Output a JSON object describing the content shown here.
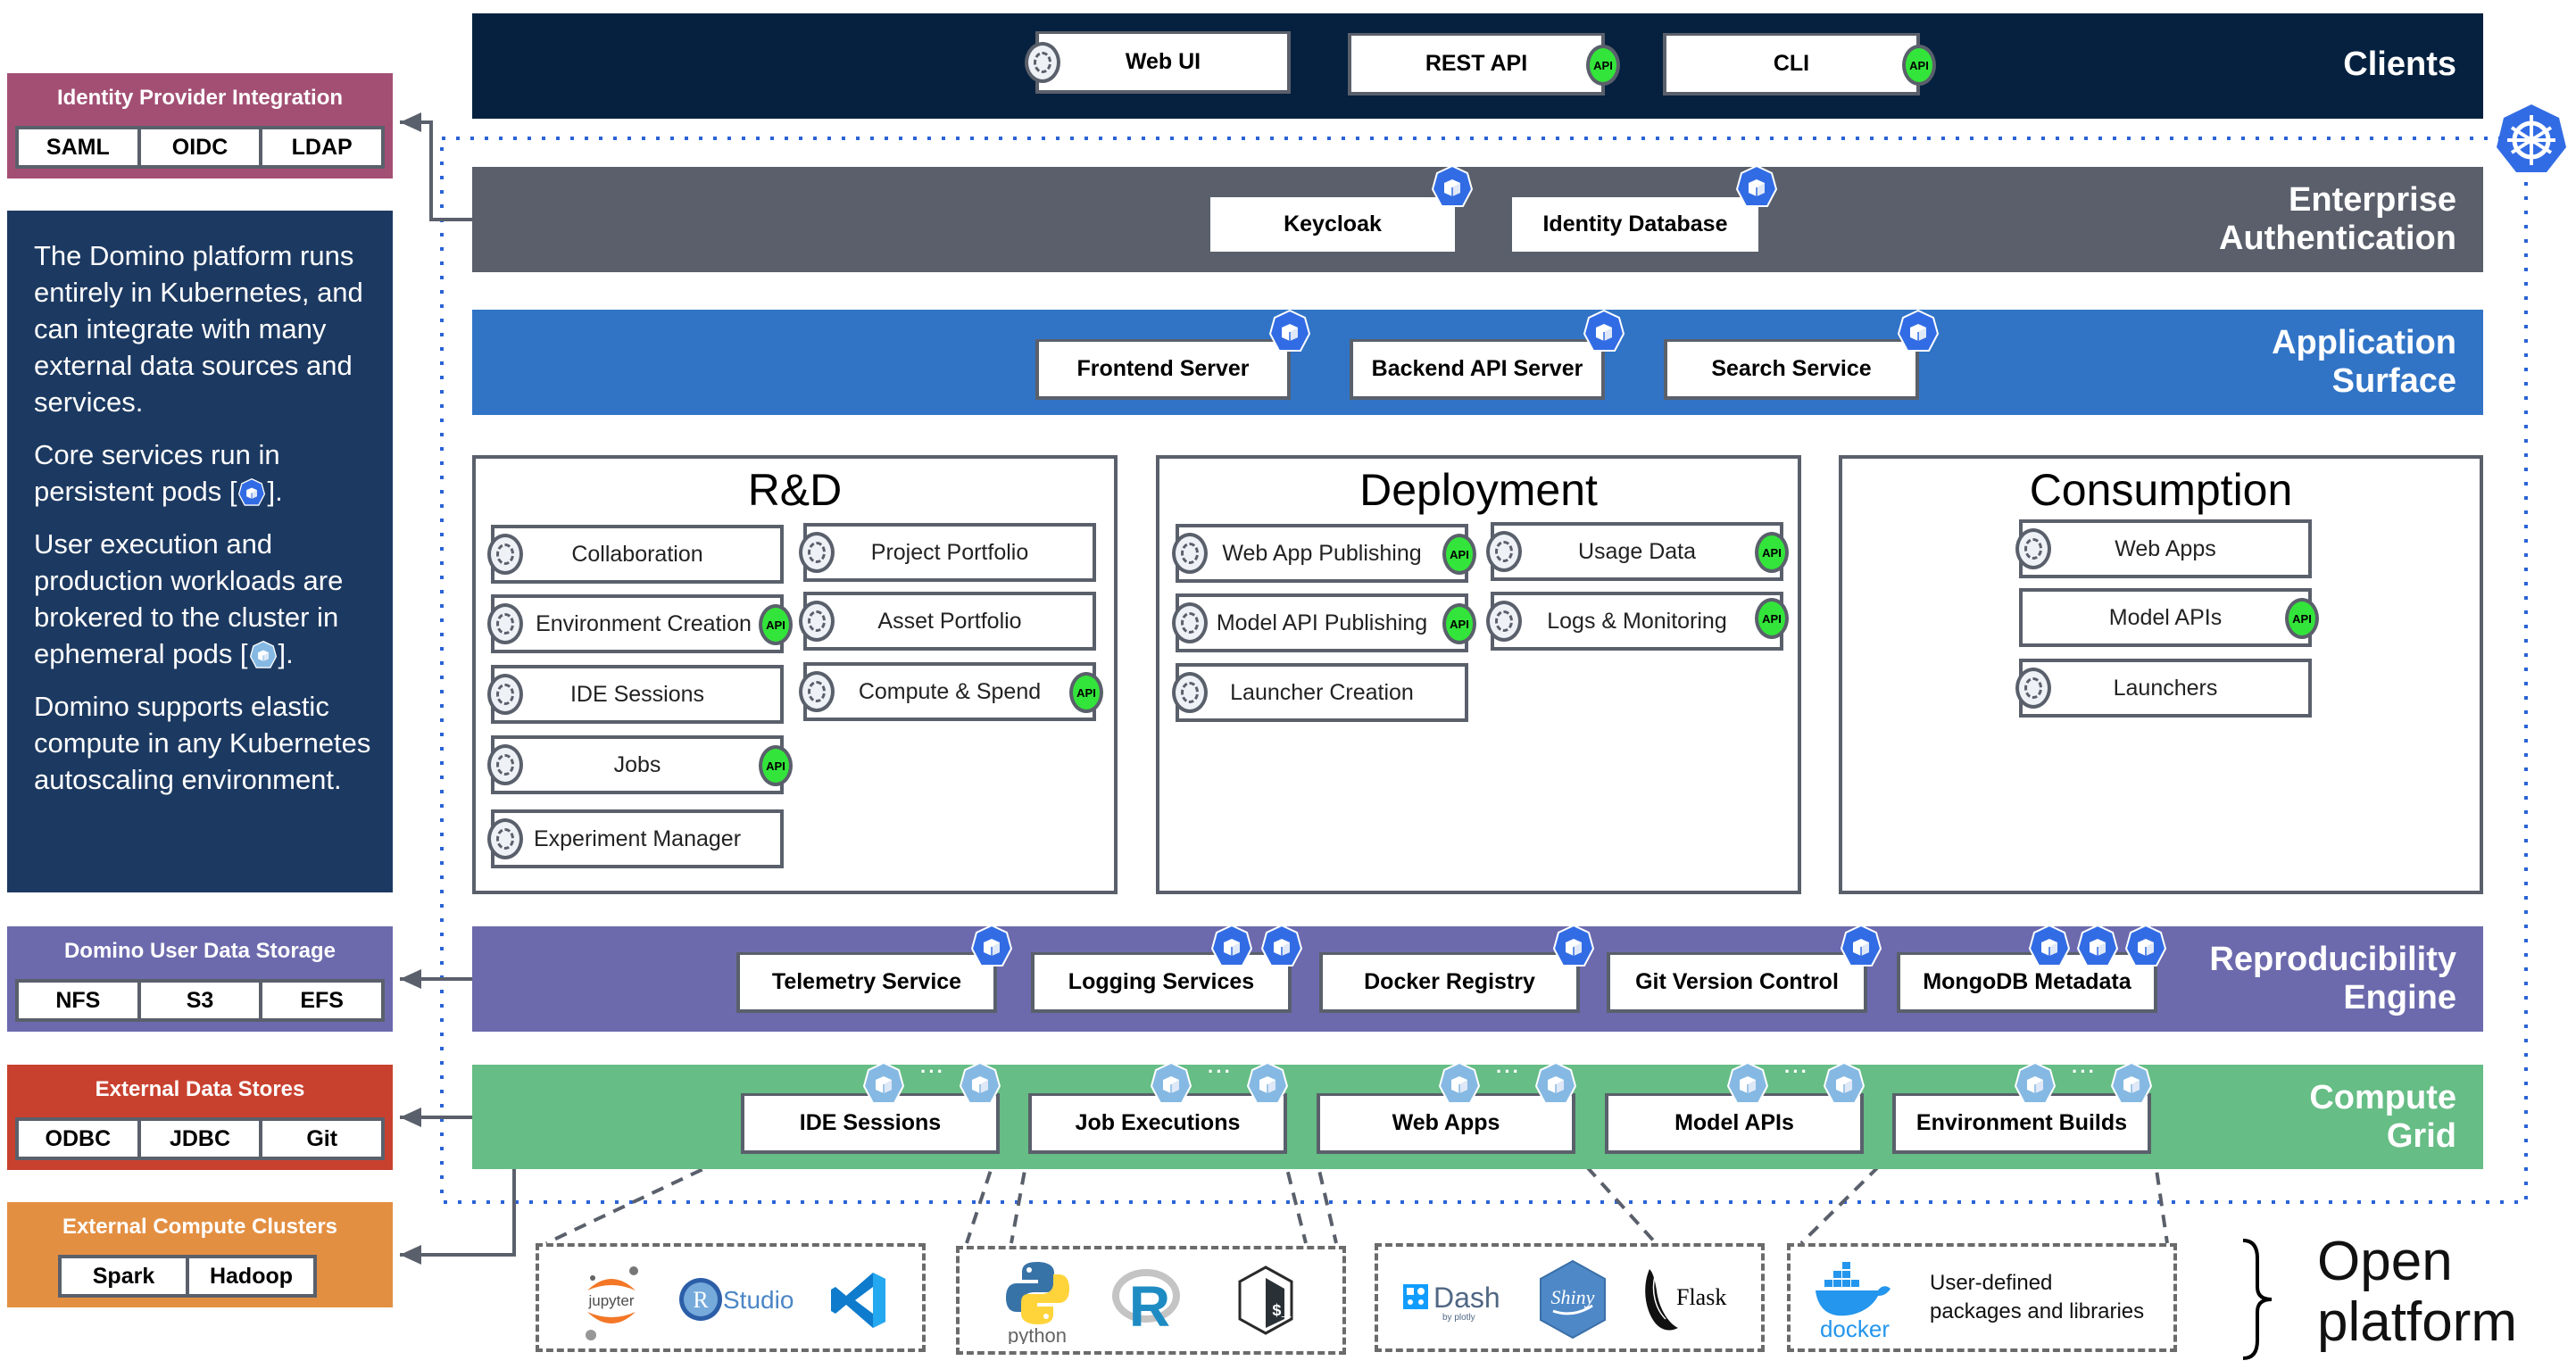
{
  "colors": {
    "clients_band": "#05213f",
    "auth_band": "#5a5f6b",
    "app_band": "#3174c6",
    "repro_band": "#6c6aad",
    "compute_band": "#66bd85",
    "identity_panel": "#a34f74",
    "info_panel": "#1c3961",
    "storage_panel": "#6c6aad",
    "data_stores_panel": "#c8412f",
    "compute_clusters_panel": "#e38f42",
    "api_badge": "#33e53a",
    "persistent_pod": "#326ce5",
    "ephemeral_pod": "#85b9e3",
    "k8s_boundary": "#2a63d6"
  },
  "clients": {
    "label": "Clients",
    "items": [
      {
        "label": "Web UI",
        "badge": "ui"
      },
      {
        "label": "REST API",
        "badge": "API"
      },
      {
        "label": "CLI",
        "badge": "API"
      }
    ]
  },
  "auth": {
    "label_line1": "Enterprise",
    "label_line2": "Authentication",
    "items": [
      {
        "label": "Keycloak",
        "pods": 1
      },
      {
        "label": "Identity Database",
        "pods": 1
      }
    ]
  },
  "app_surface": {
    "label_line1": "Application",
    "label_line2": "Surface",
    "items": [
      {
        "label": "Frontend Server",
        "pods": 1
      },
      {
        "label": "Backend API Server",
        "pods": 1
      },
      {
        "label": "Search Service",
        "pods": 1
      }
    ]
  },
  "rnd": {
    "title": "R&D",
    "left": [
      {
        "label": "Collaboration",
        "api": false
      },
      {
        "label": "Environment Creation",
        "api": true
      },
      {
        "label": "IDE Sessions",
        "api": false
      },
      {
        "label": "Jobs",
        "api": true
      },
      {
        "label": "Experiment Manager",
        "api": false
      }
    ],
    "right": [
      {
        "label": "Project Portfolio",
        "api": false
      },
      {
        "label": "Asset Portfolio",
        "api": false
      },
      {
        "label": "Compute & Spend",
        "api": true
      }
    ]
  },
  "deployment": {
    "title": "Deployment",
    "left": [
      {
        "label": "Web App Publishing",
        "api": true
      },
      {
        "label": "Model API Publishing",
        "api": true
      },
      {
        "label": "Launcher Creation",
        "api": false
      }
    ],
    "right": [
      {
        "label": "Usage Data",
        "api": true
      },
      {
        "label": "Logs & Monitoring",
        "api": true
      }
    ]
  },
  "consumption": {
    "title": "Consumption",
    "items": [
      {
        "label": "Web Apps",
        "api": false,
        "ui": true
      },
      {
        "label": "Model APIs",
        "api": true,
        "ui": false
      },
      {
        "label": "Launchers",
        "api": false,
        "ui": true
      }
    ]
  },
  "repro": {
    "label_line1": "Reproducibility",
    "label_line2": "Engine",
    "items": [
      {
        "label": "Telemetry Service",
        "pods": 1
      },
      {
        "label": "Logging Services",
        "pods": 2
      },
      {
        "label": "Docker Registry",
        "pods": 1
      },
      {
        "label": "Git Version Control",
        "pods": 1
      },
      {
        "label": "MongoDB Metadata",
        "pods": 3
      }
    ]
  },
  "compute": {
    "label_line1": "Compute",
    "label_line2": "Grid",
    "ellipsis": "···",
    "items": [
      {
        "label": "IDE Sessions"
      },
      {
        "label": "Job Executions"
      },
      {
        "label": "Web Apps"
      },
      {
        "label": "Model APIs"
      },
      {
        "label": "Environment Builds"
      }
    ]
  },
  "identity_provider": {
    "title": "Identity Provider Integration",
    "cells": [
      "SAML",
      "OIDC",
      "LDAP"
    ]
  },
  "info": {
    "p1": "The Domino platform runs entirely in Kubernetes, and can integrate with many external data sources and services.",
    "p2_before": "Core services run in persistent pods [",
    "p2_after": "].",
    "p3_before": "User execution and production workloads are brokered to the cluster in ephemeral pods [",
    "p3_after": "].",
    "p4": "Domino supports elastic compute in any Kubernetes autoscaling environment."
  },
  "user_data_storage": {
    "title": "Domino User Data Storage",
    "cells": [
      "NFS",
      "S3",
      "EFS"
    ]
  },
  "external_data_stores": {
    "title": "External Data Stores",
    "cells": [
      "ODBC",
      "JDBC",
      "Git"
    ]
  },
  "external_compute": {
    "title": "External Compute Clusters",
    "cells": [
      "Spark",
      "Hadoop"
    ]
  },
  "open_platform": {
    "line1": "Open",
    "line2": "platform",
    "groups": [
      {
        "logos": [
          "jupyter",
          "RStudio",
          "VS Code"
        ]
      },
      {
        "logos": [
          "python",
          "R",
          "bash"
        ]
      },
      {
        "logos": [
          "Dash",
          "Shiny",
          "Flask"
        ]
      },
      {
        "logos": [
          "docker"
        ],
        "text_line1": "User-defined",
        "text_line2": "packages and libraries"
      }
    ],
    "jupyter_text": "jupyter",
    "rstudio_r": "R",
    "rstudio_text": "Studio",
    "python_text": "python",
    "r_text": "R",
    "bash_text": "$_",
    "dash_text": "Dash",
    "dash_sub": "by plotly",
    "shiny_text": "Shiny",
    "flask_text": "Flask",
    "docker_text": "docker"
  }
}
